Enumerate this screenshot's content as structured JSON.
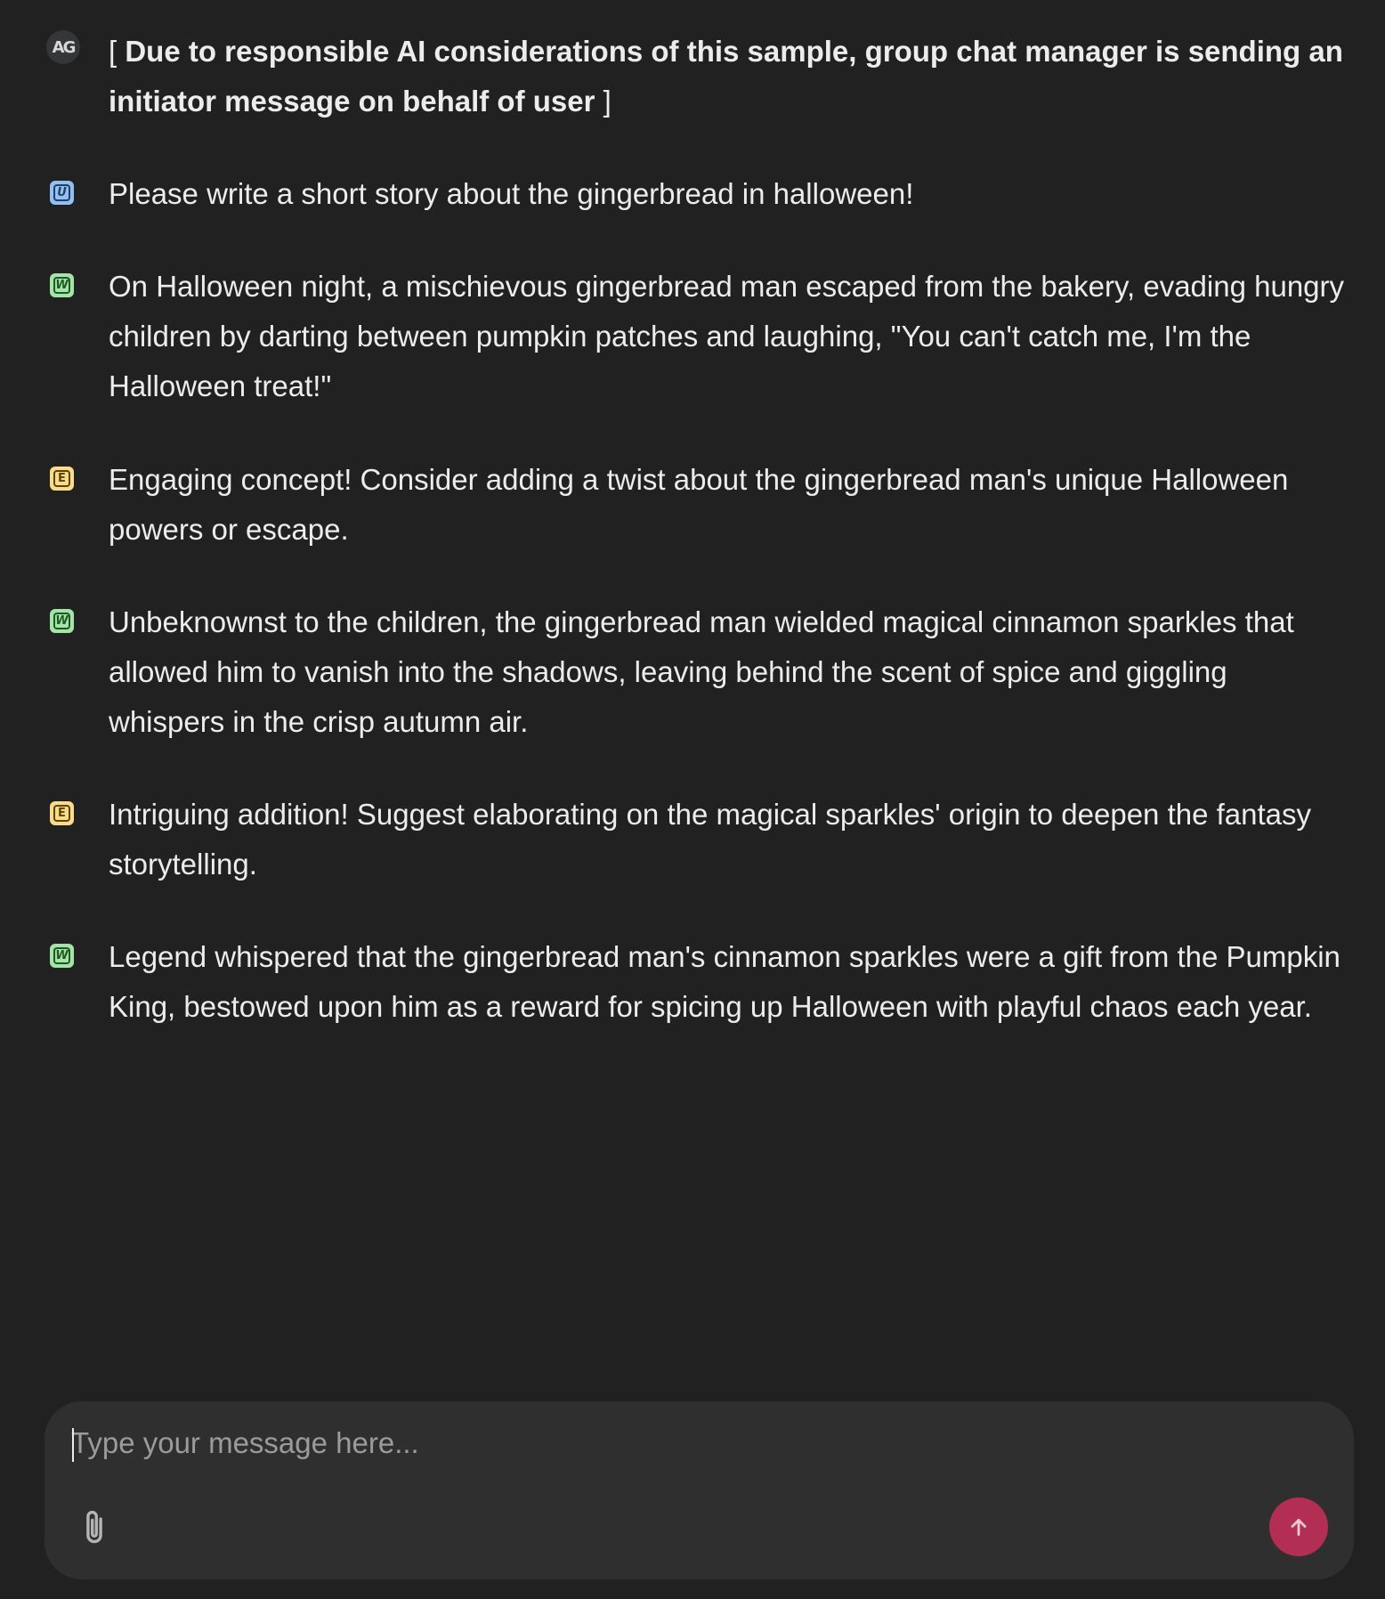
{
  "messages": [
    {
      "avatar": "AG",
      "avatar_icon": "autogen-logo-icon",
      "text_prefix": "[ ",
      "text": "Due to responsible AI considerations of this sample, group chat manager is sending an initiator message on behalf of user",
      "text_suffix": " ]",
      "bold": true
    },
    {
      "avatar": "U",
      "avatar_icon": "user-agent-icon",
      "avatar_color": "#93c0f0",
      "text": "Please write a short story about the gingerbread in halloween!"
    },
    {
      "avatar": "W",
      "avatar_icon": "writer-agent-icon",
      "avatar_color": "#a6e3a8",
      "text": "On Halloween night, a mischievous gingerbread man escaped from the bakery, evading hungry children by darting between pumpkin patches and laughing, \"You can't catch me, I'm the Halloween treat!\""
    },
    {
      "avatar": "E",
      "avatar_icon": "editor-agent-icon",
      "avatar_color": "#f8dc8a",
      "text": "Engaging concept! Consider adding a twist about the gingerbread man's unique Halloween powers or escape."
    },
    {
      "avatar": "W",
      "avatar_icon": "writer-agent-icon",
      "avatar_color": "#a6e3a8",
      "text": "Unbeknownst to the children, the gingerbread man wielded magical cinnamon sparkles that allowed him to vanish into the shadows, leaving behind the scent of spice and giggling whispers in the crisp autumn air."
    },
    {
      "avatar": "E",
      "avatar_icon": "editor-agent-icon",
      "avatar_color": "#f8dc8a",
      "text": "Intriguing addition! Suggest elaborating on the magical sparkles' origin to deepen the fantasy storytelling."
    },
    {
      "avatar": "W",
      "avatar_icon": "writer-agent-icon",
      "avatar_color": "#a6e3a8",
      "text": "Legend whispered that the gingerbread man's cinnamon sparkles were a gift from the Pumpkin King, bestowed upon him as a reward for spicing up Halloween with playful chaos each year."
    }
  ],
  "composer": {
    "placeholder": "Type your message here...",
    "value": "",
    "attach_icon": "paperclip-icon",
    "send_icon": "arrow-up-icon",
    "send_color": "#b22e52"
  },
  "colors": {
    "background": "#212121",
    "composer_background": "#2f2f2f",
    "text": "#ececec"
  }
}
